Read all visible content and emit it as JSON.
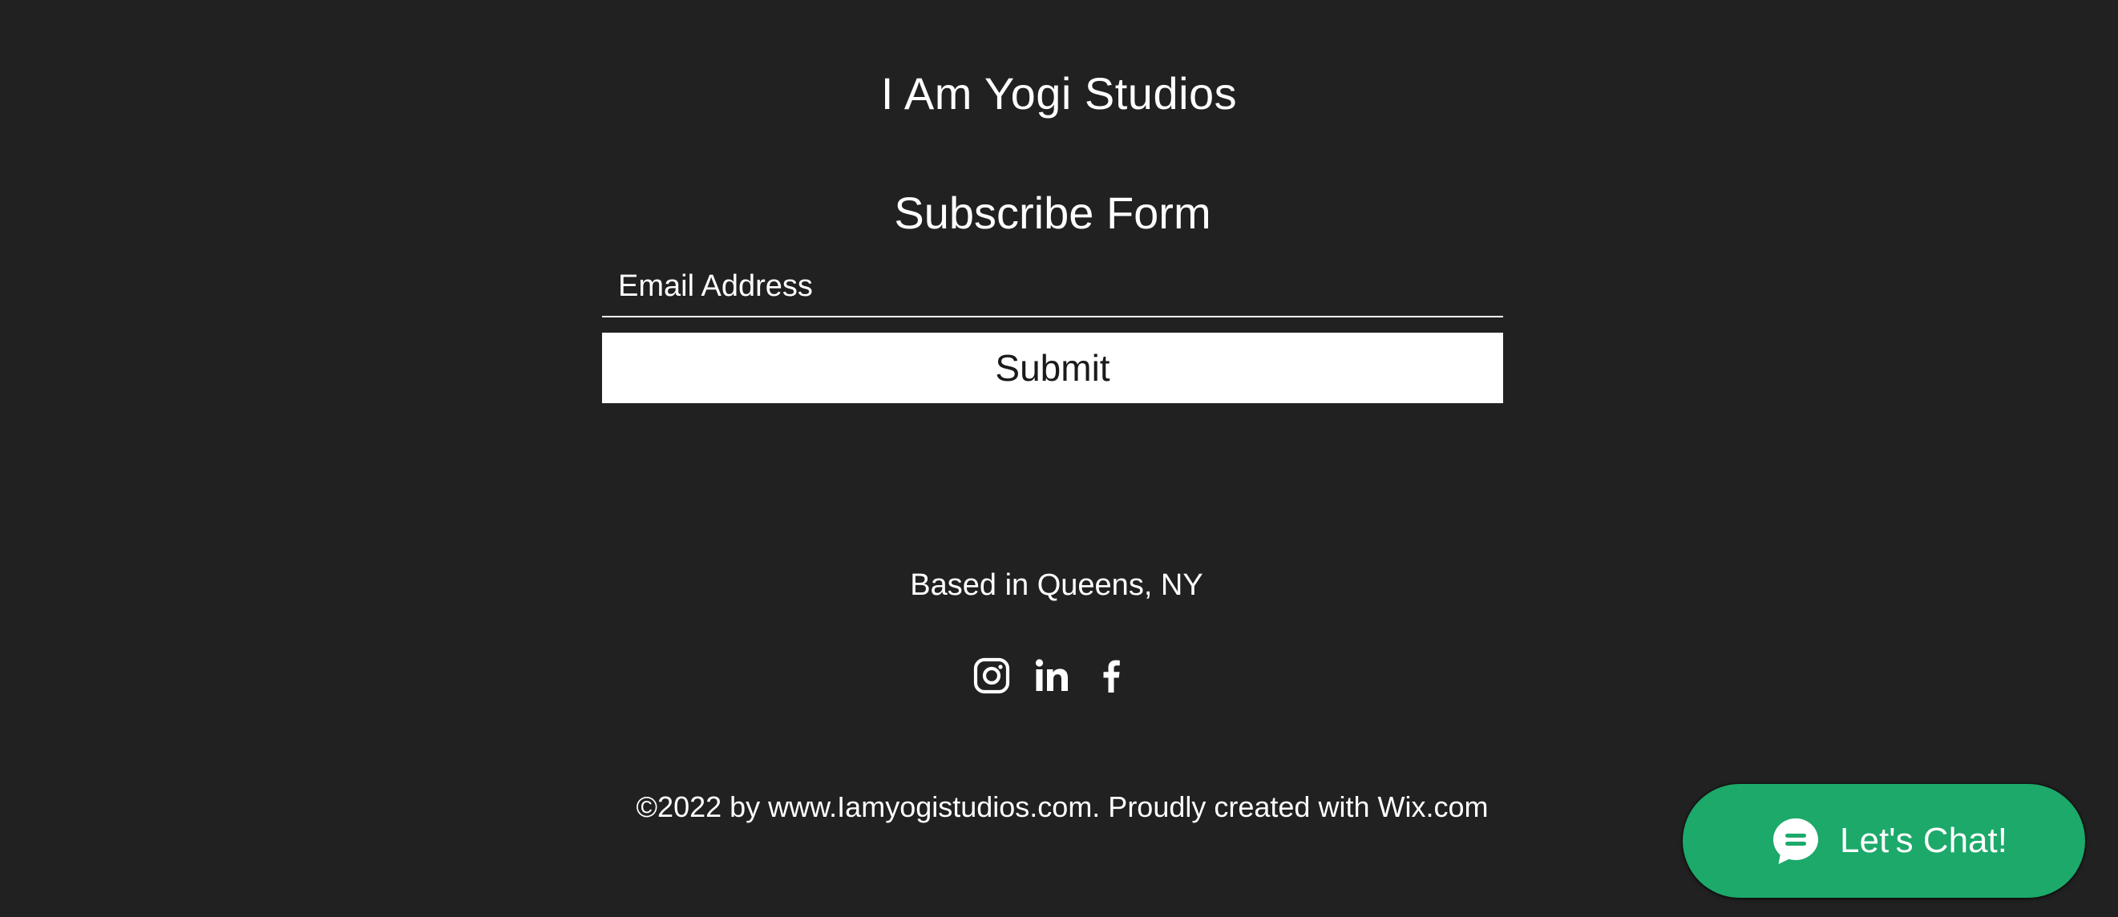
{
  "site": {
    "title": "I Am Yogi Studios"
  },
  "subscribe": {
    "title": "Subscribe Form",
    "email_placeholder": "Email Address",
    "submit_label": "Submit"
  },
  "footer": {
    "location": "Based in Queens, NY",
    "social": [
      {
        "name": "instagram-icon"
      },
      {
        "name": "linkedin-icon"
      },
      {
        "name": "facebook-icon"
      }
    ],
    "copyright": "©2022 by www.Iamyogistudios.com. Proudly created with Wix.com"
  },
  "chat": {
    "label": "Let's Chat!",
    "icon": "chat-bubble-icon",
    "color": "#1ca96a"
  },
  "colors": {
    "background": "#212121",
    "text": "#ffffff",
    "button_bg": "#ffffff",
    "button_text": "#1a1a1a"
  }
}
